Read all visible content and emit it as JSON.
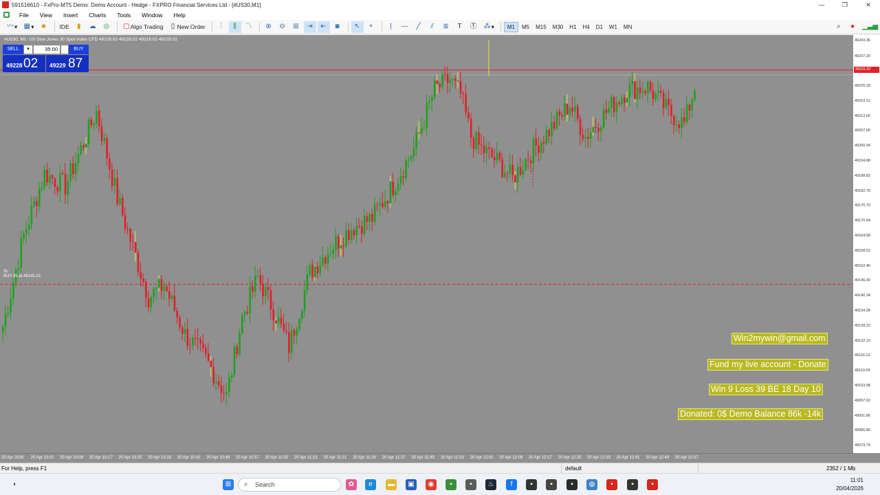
{
  "window": {
    "title": "591516610 - FxPro-MT5 Demo: Demo Account - Hedge - FXPRO Financial Services Ltd - [#US30,M1]",
    "minimize": "—",
    "restore": "❐",
    "close": "✕"
  },
  "menu": [
    "File",
    "View",
    "Insert",
    "Charts",
    "Tools",
    "Window",
    "Help"
  ],
  "toolbar": {
    "algo_trading": "Algo Trading",
    "new_order": "New Order",
    "ide": "IDE",
    "timeframes": [
      "M1",
      "M5",
      "M15",
      "M30",
      "H1",
      "H4",
      "D1",
      "W1",
      "MN"
    ],
    "active_timeframe": "M1"
  },
  "chart": {
    "symbol_line": "#US30, M1: US Dow Jones 30 Spot Index CFD   49228.02 49228.02 49219.02 49228.02",
    "background": "#909090",
    "bull_color": "#1fa01f",
    "bear_color": "#e01e28",
    "sl_text": "SL",
    "order_text": "BUY 35 at 49145.22",
    "current_price_tag": "49231.87"
  },
  "trade_panel": {
    "sell_label": "SELL",
    "buy_label": "BUY",
    "volume": "35.00",
    "sell_price_small": "49228",
    "sell_price_big": "02",
    "buy_price_small": "49229",
    "buy_price_big": "87"
  },
  "overlay_labels": {
    "email": "Win2mywin@gmail.com",
    "donate": "Fund my live account - Donate",
    "stats": "Win 9  Loss 39  BE 18  Day 10",
    "balance": "Donated: 0$  Demo Balance 86k -14k"
  },
  "price_axis": [
    "49243.36",
    "49237.20",
    "49231.24",
    "49225.18",
    "49219.12",
    "49213.06",
    "49207.00",
    "49200.94",
    "49194.88",
    "49188.82",
    "49182.76",
    "49176.70",
    "49170.64",
    "49164.58",
    "49158.52",
    "49152.46",
    "49146.40",
    "49140.34",
    "49134.28",
    "49128.22",
    "49122.16",
    "49116.10",
    "49110.04",
    "49103.98",
    "49097.92",
    "49091.86",
    "49085.80",
    "49079.74"
  ],
  "time_axis": [
    "20 Apr 2026",
    "20 Apr 10:01",
    "20 Apr 10:09",
    "20 Apr 10:17",
    "20 Apr 10:25",
    "20 Apr 10:33",
    "20 Apr 10:41",
    "20 Apr 10:49",
    "20 Apr 10:57",
    "20 Apr 11:05",
    "20 Apr 11:13",
    "20 Apr 11:21",
    "20 Apr 11:29",
    "20 Apr 11:37",
    "20 Apr 11:45",
    "20 Apr 11:53",
    "20 Apr 12:01",
    "20 Apr 12:09",
    "20 Apr 12:17",
    "20 Apr 12:25",
    "20 Apr 12:33",
    "20 Apr 12:41",
    "20 Apr 12:49",
    "20 Apr 12:57"
  ],
  "chart_data": {
    "type": "candlestick",
    "symbol": "#US30",
    "timeframe": "M1",
    "ylim": [
      49077,
      49246
    ],
    "current_price": 49231.87,
    "order_line": 49145.22,
    "close_path": [
      [
        0,
        49128
      ],
      [
        8,
        49165
      ],
      [
        16,
        49190
      ],
      [
        24,
        49185
      ],
      [
        30,
        49200
      ],
      [
        36,
        49215
      ],
      [
        44,
        49180
      ],
      [
        50,
        49160
      ],
      [
        56,
        49140
      ],
      [
        62,
        49145
      ],
      [
        70,
        49125
      ],
      [
        78,
        49115
      ],
      [
        86,
        49100
      ],
      [
        92,
        49132
      ],
      [
        98,
        49148
      ],
      [
        104,
        49135
      ],
      [
        110,
        49120
      ],
      [
        118,
        49150
      ],
      [
        126,
        49160
      ],
      [
        134,
        49168
      ],
      [
        142,
        49172
      ],
      [
        150,
        49185
      ],
      [
        158,
        49200
      ],
      [
        166,
        49224
      ],
      [
        172,
        49228
      ],
      [
        176,
        49222
      ],
      [
        180,
        49205
      ],
      [
        184,
        49200
      ],
      [
        190,
        49195
      ],
      [
        196,
        49188
      ],
      [
        204,
        49200
      ],
      [
        212,
        49210
      ],
      [
        218,
        49218
      ],
      [
        224,
        49205
      ],
      [
        232,
        49215
      ],
      [
        240,
        49224
      ],
      [
        248,
        49225
      ],
      [
        256,
        49215
      ],
      [
        262,
        49210
      ],
      [
        266,
        49225
      ]
    ]
  },
  "status": {
    "help": "For Help, press F1",
    "profile": "default",
    "traffic": "2352 / 1 Mb"
  },
  "taskbar": {
    "search": "Search",
    "time": "11:01",
    "date": "20/04/2026"
  }
}
